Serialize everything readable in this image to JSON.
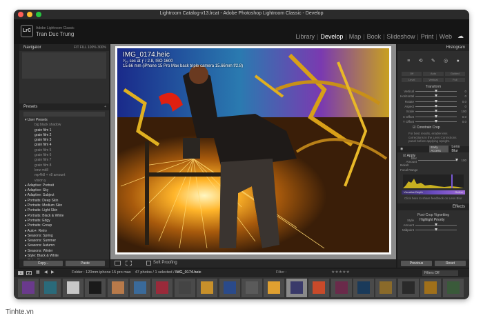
{
  "window": {
    "title": "Lightroom Catalog-v13.lrcat - Adobe Photoshop Lightroom Classic - Develop",
    "traffic_colors": [
      "#ff5f57",
      "#febc2e",
      "#28c840"
    ]
  },
  "identity": {
    "logo": "LrC",
    "subtitle": "Adobe Lightroom Classic",
    "user": "Tran Duc Trung"
  },
  "modules": [
    "Library",
    "Develop",
    "Map",
    "Book",
    "Slideshow",
    "Print",
    "Web"
  ],
  "active_module": "Develop",
  "left_panel": {
    "navigator": {
      "title": "Navigator",
      "zoom": "FIT  FILL  100%  300%"
    },
    "presets_title": "Presets",
    "user_presets_group": "User Presets",
    "user_presets": [
      "big black shadow",
      "grain film 1",
      "grain film 2",
      "grain film 3",
      "grain film 4",
      "grain film 5",
      "grain film 6",
      "grain film 7",
      "grain film 8",
      "lenz mk8",
      "mp4h8 + v8 amount",
      "vision y"
    ],
    "groups": [
      "Adaptive: Portrait",
      "Adaptive: Sky",
      "Adaptive: Subject",
      "Portraits: Deep Skin",
      "Portraits: Medium Skin",
      "Portraits: Light Skin",
      "Portraits: Black & White",
      "Portraits: Edgy",
      "Portraits: Group",
      "Auto+: Retro",
      "Seasons: Spring",
      "Seasons: Summer",
      "Seasons: Autumn",
      "Seasons: Winter",
      "Style: Black & White",
      "Style: Cinematic",
      "Style: Cinematic II",
      "Style: Futuristic"
    ],
    "copy_label": "Copy...",
    "paste_label": "Paste"
  },
  "photo": {
    "filename": "IMG_0174.heic",
    "exposure": "¹⁄₅₀ sec at ƒ / 2.8, ISO 1600",
    "lens": "15.66 mm (iPhone 15 Pro Max back triple camera 15.66mm f/2.8)"
  },
  "toolbar": {
    "soft_proofing": "Soft Proofing"
  },
  "right_panel": {
    "histogram_title": "Histogram",
    "tool_icons": [
      "≡",
      "⟲",
      "✎",
      "◎",
      "●"
    ],
    "upright_buttons": [
      "Off",
      "Auto",
      "Guided",
      "Level",
      "Vertical",
      "Full"
    ],
    "transform_title": "Transform",
    "transform_sliders": [
      {
        "label": "Vertical",
        "value": "0",
        "pos": 0.5
      },
      {
        "label": "Horizontal",
        "value": "0",
        "pos": 0.5
      },
      {
        "label": "Rotate",
        "value": "0.0",
        "pos": 0.5
      },
      {
        "label": "Aspect",
        "value": "0",
        "pos": 0.5
      },
      {
        "label": "Scale",
        "value": "100",
        "pos": 0.5
      },
      {
        "label": "X Offset",
        "value": "0.0",
        "pos": 0.5
      },
      {
        "label": "Y Offset",
        "value": "0.0",
        "pos": 0.5
      }
    ],
    "constrain_crop": "Constrain Crop",
    "note": "For best results, enable lens corrections in the Lens Corrections panel before applying Upright.",
    "early_access": "Early Access",
    "lens_blur": "Lens Blur",
    "apply": "Apply",
    "blur_amount_label": "Blur Amount",
    "blur_amount": "100",
    "bokeh": "Bokeh",
    "focal_range": "Focal Range",
    "visualize_depth": "Visualize Depth",
    "refine": "Refine",
    "feedback": "Click here to share feedback on Lens Blur",
    "effects": "Effects",
    "post_crop": "Post-Crop Vignetting",
    "style_label": "Style",
    "style_value": "Highlight Priority",
    "amount_label": "Amount",
    "midpoint_label": "Midpoint",
    "previous_label": "Previous",
    "reset_label": "Reset"
  },
  "filmstrip_bar": {
    "page1": "1",
    "page2": "2",
    "folder": "Folder : 120mm iphone 15 pro max",
    "count": "47 photos / 1 selected /",
    "current": "IMG_0174.heic",
    "filter_label": "Filter :",
    "filters_off": "Filters Off"
  },
  "filmstrip": {
    "thumb_colors": [
      "#6a3a8c",
      "#2a6a7a",
      "#c8c8c8",
      "#1a1a1a",
      "#b87a4a",
      "#3a6a9a",
      "#9a2a3a",
      "#444444",
      "#c8902a",
      "#2a4a8a",
      "#5a5a5a",
      "#e0a030",
      "#3a3a6a",
      "#c84a2a",
      "#6a2a4a",
      "#1a3a5a",
      "#8a6a2a",
      "#2a2a2a",
      "#a0701a",
      "#3a5a3a"
    ],
    "selected_index": 12
  },
  "watermark": "Tinhte.vn"
}
